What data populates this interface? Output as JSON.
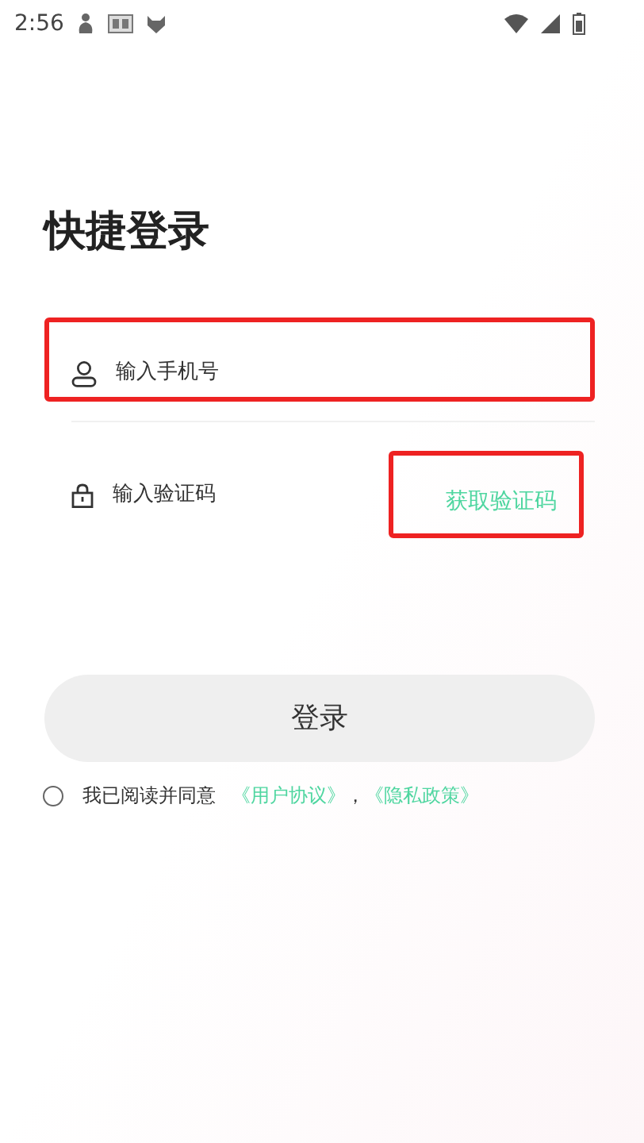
{
  "status_bar": {
    "time": "2:56"
  },
  "title": "快捷登录",
  "phone_field": {
    "placeholder": "输入手机号",
    "highlighted": true
  },
  "code_field": {
    "placeholder": "输入验证码",
    "highlighted": false
  },
  "get_code_button": {
    "label": "获取验证码",
    "highlighted": true
  },
  "login_button": {
    "label": "登录"
  },
  "agreement": {
    "checked": false,
    "text": "我已阅读并同意",
    "links": [
      "《用户协议》",
      "《隐私政策》"
    ],
    "separator": "，"
  }
}
